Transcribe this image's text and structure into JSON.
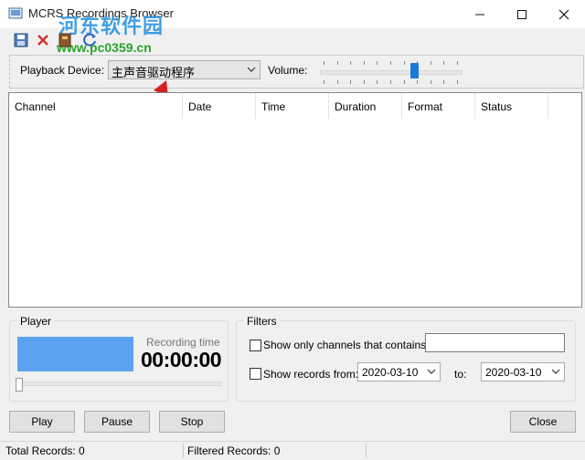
{
  "window": {
    "title": "MCRS Recordings Browser"
  },
  "watermark": {
    "title": "河东软件园",
    "url": "www.pc0359.cn"
  },
  "toolbar": {
    "icons": [
      "save-icon",
      "delete-icon",
      "export-icon",
      "refresh-icon"
    ]
  },
  "playback": {
    "device_label": "Playback Device:",
    "device_value": "主声音驱动程序",
    "volume_label": "Volume:",
    "volume_level": 0.68
  },
  "list": {
    "columns": [
      "Channel",
      "Date",
      "Time",
      "Duration",
      "Format",
      "Status"
    ],
    "rows": []
  },
  "player": {
    "group_label": "Player",
    "recording_time_label": "Recording time",
    "recording_time": "00:00:00",
    "seek_position": 0
  },
  "filters": {
    "group_label": "Filters",
    "channels_label": "Show only channels that contains:",
    "channels_value": "",
    "records_from_label": "Show records from:",
    "from_date": "2020-03-10",
    "to_label": "to:",
    "to_date": "2020-03-10"
  },
  "buttons": {
    "play": "Play",
    "pause": "Pause",
    "stop": "Stop",
    "close": "Close"
  },
  "status": {
    "total": "Total Records: 0",
    "filtered": "Filtered Records: 0"
  },
  "colors": {
    "accent": "#1979d7",
    "preview": "#5ba2f0",
    "annotation_arrow": "#d62020"
  }
}
